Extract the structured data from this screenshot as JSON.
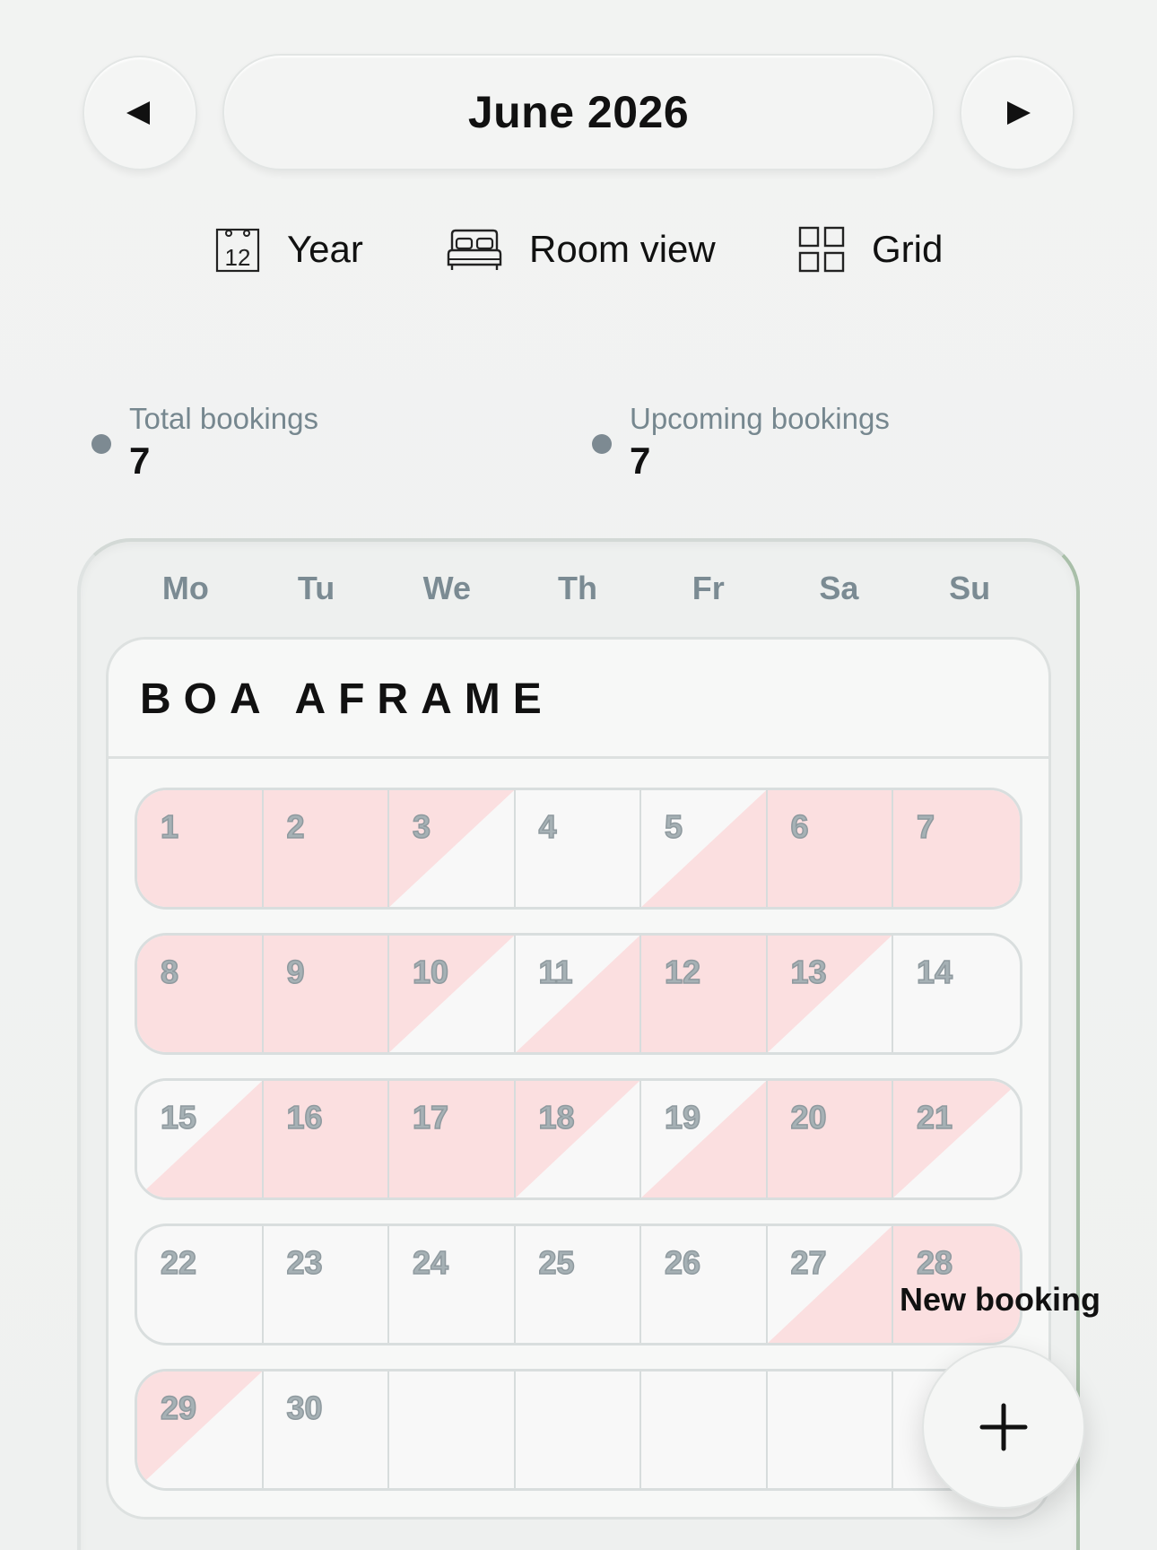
{
  "header": {
    "month_title": "June 2026",
    "prev_icon": "triangle-left-icon",
    "next_icon": "triangle-right-icon"
  },
  "views": [
    {
      "label": "Year",
      "icon": "calendar-12-icon",
      "calendar_number": "12"
    },
    {
      "label": "Room view",
      "icon": "bed-icon"
    },
    {
      "label": "Grid",
      "icon": "grid-icon"
    }
  ],
  "stats": {
    "total": {
      "label": "Total bookings",
      "value": "7"
    },
    "upcoming": {
      "label": "Upcoming bookings",
      "value": "7"
    }
  },
  "calendar": {
    "weekdays": [
      "Mo",
      "Tu",
      "We",
      "Th",
      "Fr",
      "Sa",
      "Su"
    ],
    "room_name": "BOA AFRAME",
    "colors": {
      "booked": "#fbdfe0",
      "free": "#f8f8f8"
    },
    "weeks": [
      [
        {
          "d": "1",
          "s": "full"
        },
        {
          "d": "2",
          "s": "full"
        },
        {
          "d": "3",
          "s": "end"
        },
        {
          "d": "4",
          "s": "free"
        },
        {
          "d": "5",
          "s": "start"
        },
        {
          "d": "6",
          "s": "full"
        },
        {
          "d": "7",
          "s": "full"
        }
      ],
      [
        {
          "d": "8",
          "s": "full"
        },
        {
          "d": "9",
          "s": "full"
        },
        {
          "d": "10",
          "s": "end"
        },
        {
          "d": "11",
          "s": "start"
        },
        {
          "d": "12",
          "s": "full"
        },
        {
          "d": "13",
          "s": "end"
        },
        {
          "d": "14",
          "s": "free"
        }
      ],
      [
        {
          "d": "15",
          "s": "start"
        },
        {
          "d": "16",
          "s": "full"
        },
        {
          "d": "17",
          "s": "full"
        },
        {
          "d": "18",
          "s": "end"
        },
        {
          "d": "19",
          "s": "start"
        },
        {
          "d": "20",
          "s": "full"
        },
        {
          "d": "21",
          "s": "end"
        }
      ],
      [
        {
          "d": "22",
          "s": "free"
        },
        {
          "d": "23",
          "s": "free"
        },
        {
          "d": "24",
          "s": "free"
        },
        {
          "d": "25",
          "s": "free"
        },
        {
          "d": "26",
          "s": "free"
        },
        {
          "d": "27",
          "s": "start"
        },
        {
          "d": "28",
          "s": "full"
        }
      ],
      [
        {
          "d": "29",
          "s": "end"
        },
        {
          "d": "30",
          "s": "free"
        },
        {
          "d": "",
          "s": "free"
        },
        {
          "d": "",
          "s": "free"
        },
        {
          "d": "",
          "s": "free"
        },
        {
          "d": "",
          "s": "free"
        },
        {
          "d": "",
          "s": "free"
        }
      ]
    ]
  },
  "fab": {
    "label": "New booking",
    "icon": "plus-icon"
  }
}
